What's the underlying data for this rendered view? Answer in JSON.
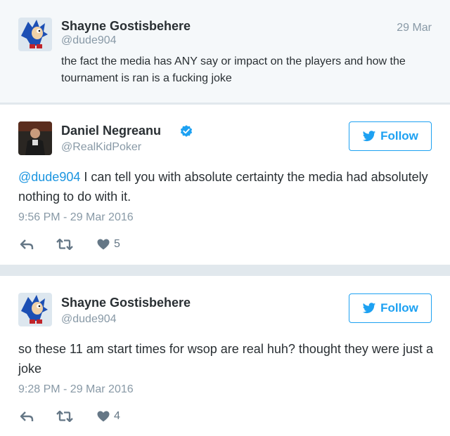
{
  "parent_tweet": {
    "display_name": "Shayne Gostisbehere",
    "handle": "@dude904",
    "date": "29 Mar",
    "text": "the fact the media has ANY say or impact on the players and how the tournament is ran is a fucking joke"
  },
  "main_tweet": {
    "display_name": "Daniel Negreanu",
    "handle": "@RealKidPoker",
    "verified": true,
    "follow_label": "Follow",
    "mention": "@dude904",
    "text": " I can tell you with absolute certainty the media had absolutely nothing to do with it.",
    "timestamp": "9:56 PM - 29 Mar 2016",
    "like_count": "5",
    "icons": [
      "reply-icon",
      "retweet-icon",
      "heart-icon",
      "verified-icon",
      "twitter-bird-icon"
    ]
  },
  "second_tweet": {
    "display_name": "Shayne Gostisbehere",
    "handle": "@dude904",
    "follow_label": "Follow",
    "text": "so these 11 am start times for wsop are real huh? thought they were just a joke",
    "timestamp": "9:28 PM - 29 Mar 2016",
    "like_count": "4"
  },
  "colors": {
    "accent": "#1da1f2",
    "mention": "#1b95e0",
    "muted": "#8899a6",
    "text": "#292f33",
    "parent_background": "#f5f8fa"
  }
}
